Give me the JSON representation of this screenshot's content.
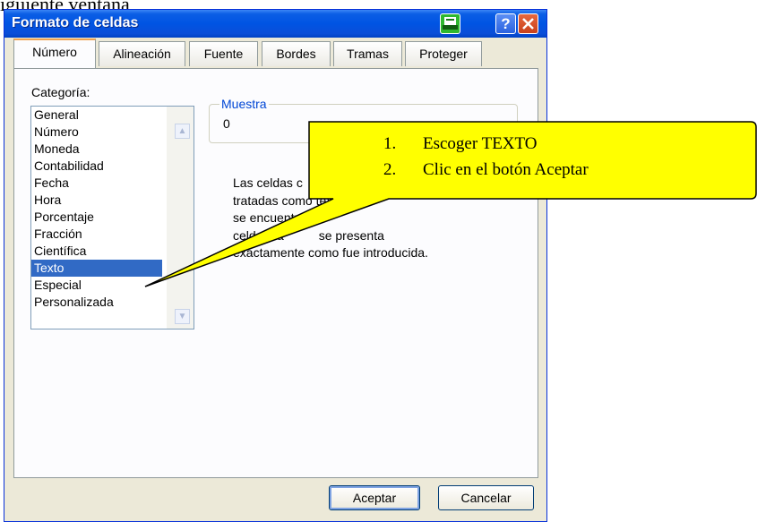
{
  "document": {
    "text": "iguiente ventana"
  },
  "window": {
    "title": "Formato de celdas",
    "help_label": "?",
    "accent_color": "#0054e3"
  },
  "tabs": [
    {
      "label": "Número",
      "active": true
    },
    {
      "label": "Alineación"
    },
    {
      "label": "Fuente"
    },
    {
      "label": "Bordes"
    },
    {
      "label": "Tramas"
    },
    {
      "label": "Proteger"
    }
  ],
  "category": {
    "label": "Categoría:",
    "items": [
      "General",
      "Número",
      "Moneda",
      "Contabilidad",
      "Fecha",
      "Hora",
      "Porcentaje",
      "Fracción",
      "Científica",
      "Texto",
      "Especial",
      "Personalizada"
    ],
    "selected": "Texto"
  },
  "sample": {
    "legend": "Muestra",
    "value": "0"
  },
  "description": {
    "lines": [
      "Las celdas c",
      "tratadas como texto",
      "se encuentre un",
      "celda. La          se presenta",
      "exactamente como fue introducida."
    ]
  },
  "buttons": {
    "ok": "Aceptar",
    "cancel": "Cancelar"
  },
  "callout": {
    "steps": [
      {
        "num": "1.",
        "text": "Escoger TEXTO"
      },
      {
        "num": "2.",
        "text": "Clic en el botón Aceptar"
      }
    ],
    "fill_color": "#ffff00"
  }
}
